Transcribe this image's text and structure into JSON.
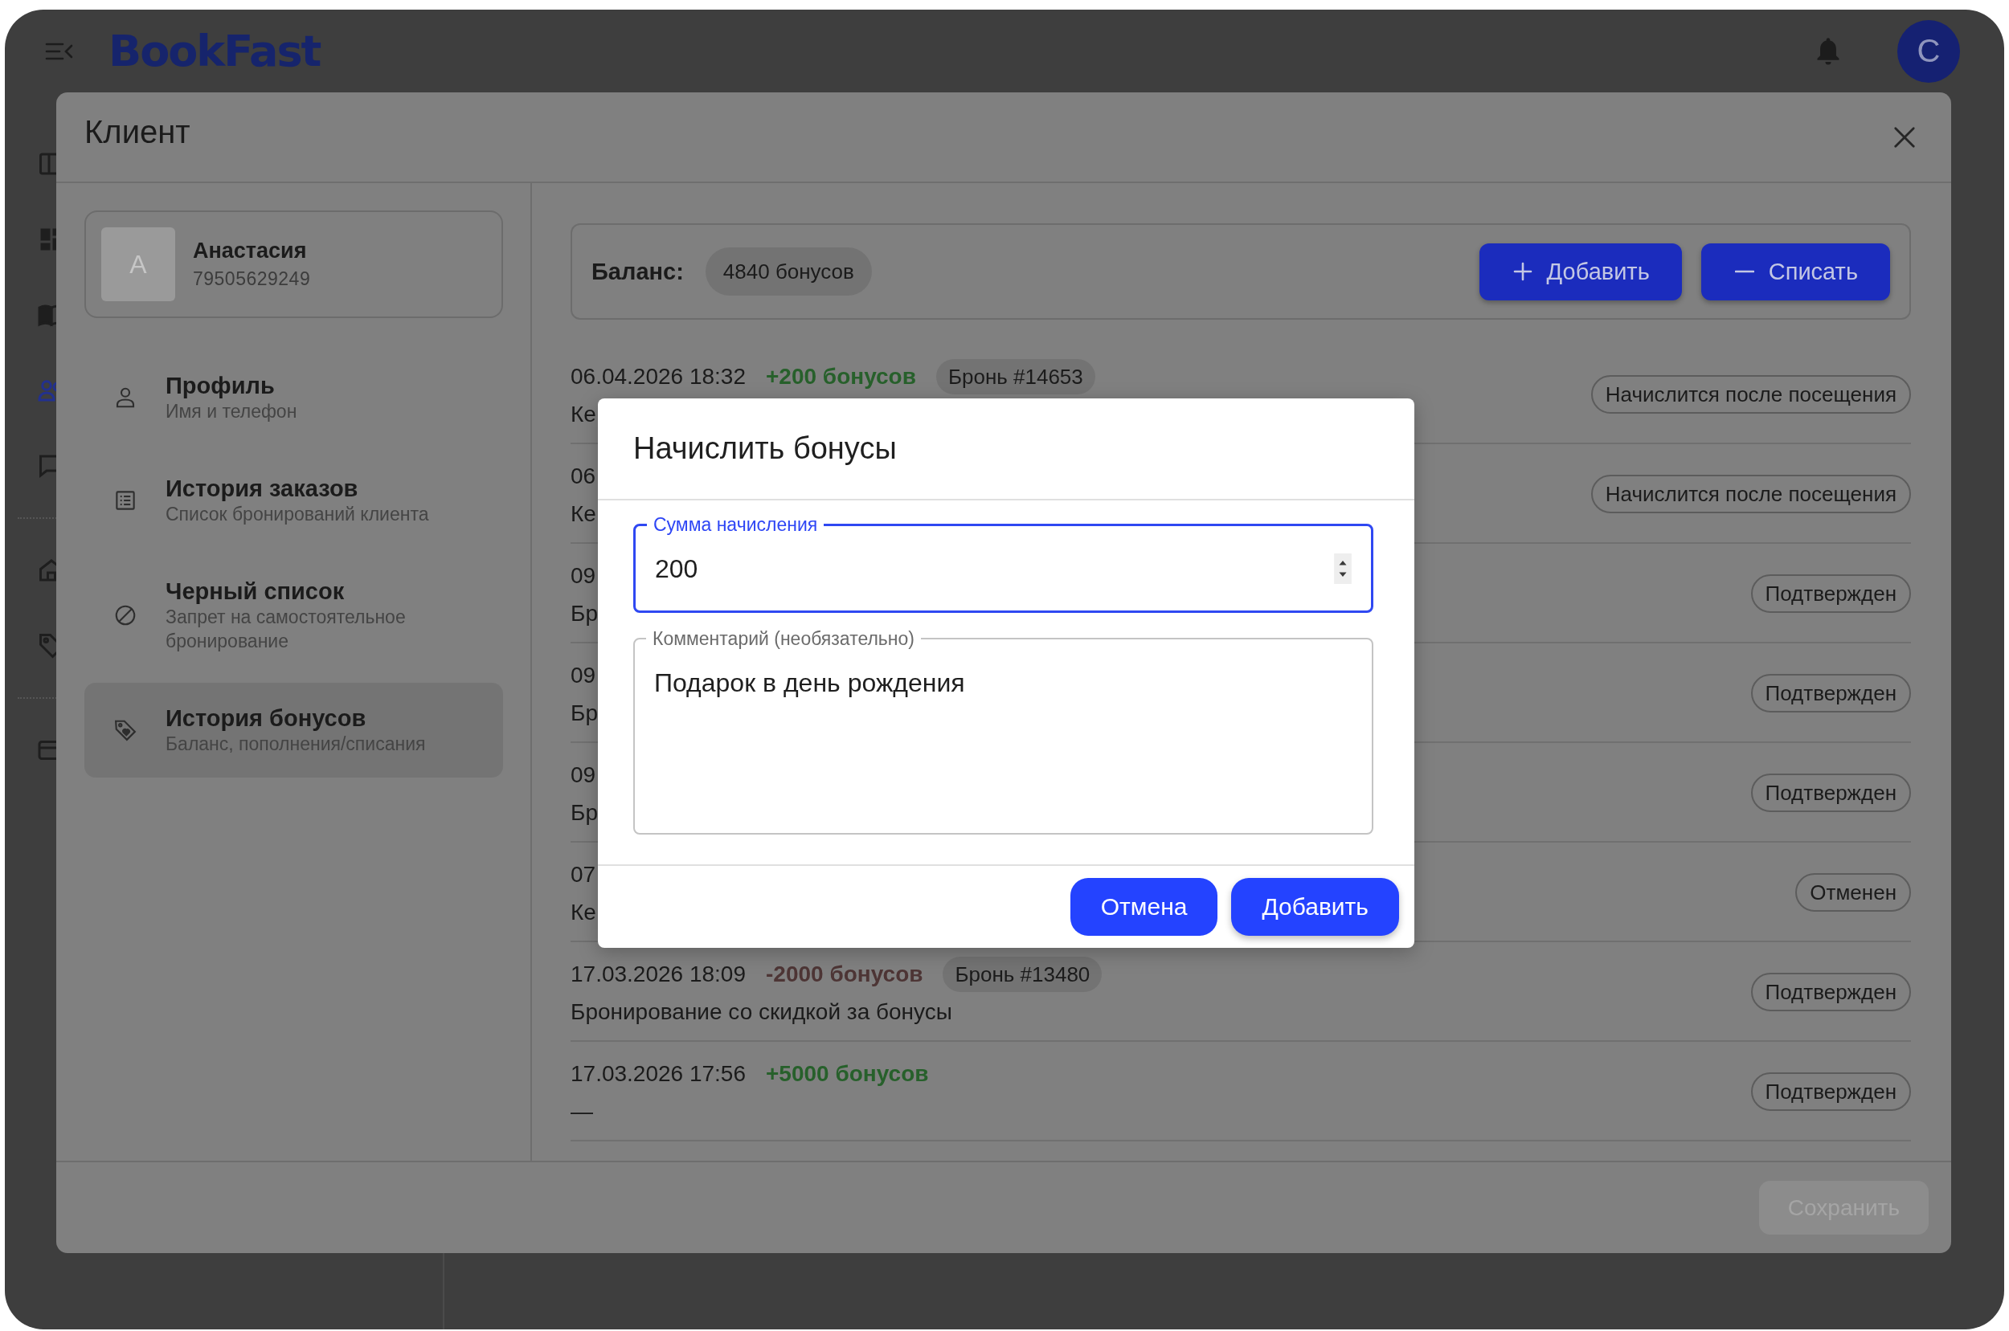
{
  "app_header": {
    "logo": "BookFast",
    "avatar_letter": "С"
  },
  "nav_rail": [
    {
      "selected": false
    },
    {
      "selected": false
    },
    {
      "selected": false
    },
    {
      "selected": true
    },
    {
      "selected": false
    },
    {
      "selected": false
    },
    {
      "selected": false
    },
    {
      "selected": false
    }
  ],
  "client_modal": {
    "title": "Клиент",
    "client": {
      "initial": "А",
      "name": "Анастасия",
      "phone": "79505629249"
    },
    "menu": [
      {
        "title": "Профиль",
        "subtitle": "Имя и телефон",
        "selected": false
      },
      {
        "title": "История заказов",
        "subtitle": "Список бронирований клиента",
        "selected": false
      },
      {
        "title": "Черный список",
        "subtitle": "Запрет на самостоятельное бронирование",
        "selected": false
      },
      {
        "title": "История бонусов",
        "subtitle": "Баланс, пополнения/списания",
        "selected": true
      }
    ],
    "balance": {
      "label": "Баланс:",
      "amount": "4840 бонусов",
      "buttons": [
        {
          "kind": "add",
          "label": "Добавить"
        },
        {
          "kind": "subtract",
          "label": "Списать"
        }
      ]
    },
    "history": [
      {
        "date": "06.04.2026 18:32",
        "amount": "+200 бонусов",
        "kind": "credit",
        "booking": "Бронь #14653",
        "description": "Ке",
        "status": "Начислится после посещения"
      },
      {
        "date": "06",
        "description": "Ке",
        "status": "Начислится после посещения"
      },
      {
        "date": "09",
        "description": "Бр",
        "status": "Подтвержден"
      },
      {
        "date": "09",
        "description": "Бр",
        "status": "Подтвержден"
      },
      {
        "date": "09",
        "description": "Бр",
        "status": "Подтвержден"
      },
      {
        "date": "07",
        "description": "Ке",
        "status": "Отменен"
      },
      {
        "date": "17.03.2026 18:09",
        "amount": "-2000 бонусов",
        "kind": "debit",
        "booking": "Бронь #13480",
        "description": "Бронирование со скидкой за бонусы",
        "status": "Подтвержден"
      },
      {
        "date": "17.03.2026 17:56",
        "amount": "+5000 бонусов",
        "kind": "credit",
        "description": "—",
        "status": "Подтвержден"
      }
    ],
    "save_button": {
      "label": "Сохранить",
      "disabled": true
    }
  },
  "dialog": {
    "title": "Начислить бонусы",
    "amount_field": {
      "label": "Сумма начисления",
      "value": "200",
      "focused": true
    },
    "comment_field": {
      "label": "Комментарий (необязательно)",
      "value": "Подарок в день рождения",
      "focused": false
    },
    "buttons": [
      {
        "label": "Отмена"
      },
      {
        "label": "Добавить"
      }
    ]
  }
}
